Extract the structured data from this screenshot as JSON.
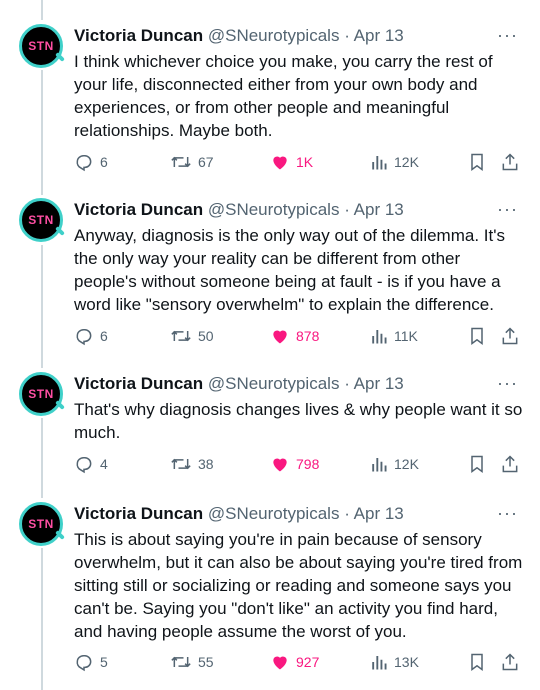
{
  "tweets": [
    {
      "author": "Victoria Duncan",
      "handle": "@SNeurotypicals",
      "separator": "·",
      "date": "Apr 13",
      "avatar_text": "STN",
      "more": "···",
      "text": "I think whichever choice you make, you carry the rest of your life, disconnected either from your own body and experiences, or from other people and meaningful relationships. Maybe both.",
      "replies": "6",
      "retweets": "67",
      "likes": "1K",
      "views": "12K"
    },
    {
      "author": "Victoria Duncan",
      "handle": "@SNeurotypicals",
      "separator": "·",
      "date": "Apr 13",
      "avatar_text": "STN",
      "more": "···",
      "text": "Anyway, diagnosis is the only way out of the dilemma. It's the only way your reality can be different from other people's without someone being at fault - is if you have a word like \"sensory overwhelm\" to explain the difference.",
      "replies": "6",
      "retweets": "50",
      "likes": "878",
      "views": "11K"
    },
    {
      "author": "Victoria Duncan",
      "handle": "@SNeurotypicals",
      "separator": "·",
      "date": "Apr 13",
      "avatar_text": "STN",
      "more": "···",
      "text": "That's why diagnosis changes lives & why people want it so much.",
      "replies": "4",
      "retweets": "38",
      "likes": "798",
      "views": "12K"
    },
    {
      "author": "Victoria Duncan",
      "handle": "@SNeurotypicals",
      "separator": "·",
      "date": "Apr 13",
      "avatar_text": "STN",
      "more": "···",
      "text": "This is about saying you're in pain because of sensory overwhelm, but it can also be about saying you're tired from sitting still or socializing or reading and someone says you can't be. Saying you \"don't like\" an activity you find hard, and having people assume the worst of you.",
      "replies": "5",
      "retweets": "55",
      "likes": "927",
      "views": "13K"
    }
  ],
  "colors": {
    "like": "#f91880",
    "muted": "#536471",
    "text": "#0f1419",
    "avatar_ring": "#3fd0c9",
    "avatar_text": "#ff4fa3"
  },
  "icons": [
    "reply-icon",
    "retweet-icon",
    "heart-icon",
    "views-icon",
    "bookmark-icon",
    "share-icon"
  ]
}
